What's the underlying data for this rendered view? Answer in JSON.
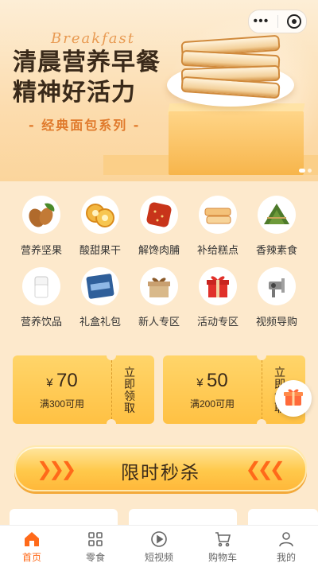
{
  "banner": {
    "script_word": "Breakfast",
    "headline_line1": "清晨营养早餐",
    "headline_line2": "精神好活力",
    "series": "- 经典面包系列 -"
  },
  "categories": [
    {
      "label": "营养坚果",
      "icon": "almond-icon"
    },
    {
      "label": "酸甜果干",
      "icon": "dried-fruit-icon"
    },
    {
      "label": "解馋肉脯",
      "icon": "jerky-icon"
    },
    {
      "label": "补给糕点",
      "icon": "pastry-icon"
    },
    {
      "label": "香辣素食",
      "icon": "zongzi-icon"
    },
    {
      "label": "营养饮品",
      "icon": "milk-icon"
    },
    {
      "label": "礼盒礼包",
      "icon": "gift-box-icon"
    },
    {
      "label": "新人专区",
      "icon": "new-user-gift-icon"
    },
    {
      "label": "活动专区",
      "icon": "red-gift-icon"
    },
    {
      "label": "视频导购",
      "icon": "video-guide-icon"
    }
  ],
  "coupons": [
    {
      "currency": "¥",
      "amount": "70",
      "condition": "满300可用",
      "action": "立即领取"
    },
    {
      "currency": "¥",
      "amount": "50",
      "condition": "满200可用",
      "action": "立即领取"
    }
  ],
  "flash_sale": {
    "title": "限时秒杀"
  },
  "tabbar": [
    {
      "label": "首页",
      "icon": "home-icon",
      "active": true
    },
    {
      "label": "零食",
      "icon": "grid-icon",
      "active": false
    },
    {
      "label": "短视频",
      "icon": "play-icon",
      "active": false
    },
    {
      "label": "购物车",
      "icon": "cart-icon",
      "active": false
    },
    {
      "label": "我的",
      "icon": "user-icon",
      "active": false
    }
  ],
  "colors": {
    "accent": "#ff6a1a",
    "coupon": "#ffc143",
    "background": "#fde9cc"
  }
}
